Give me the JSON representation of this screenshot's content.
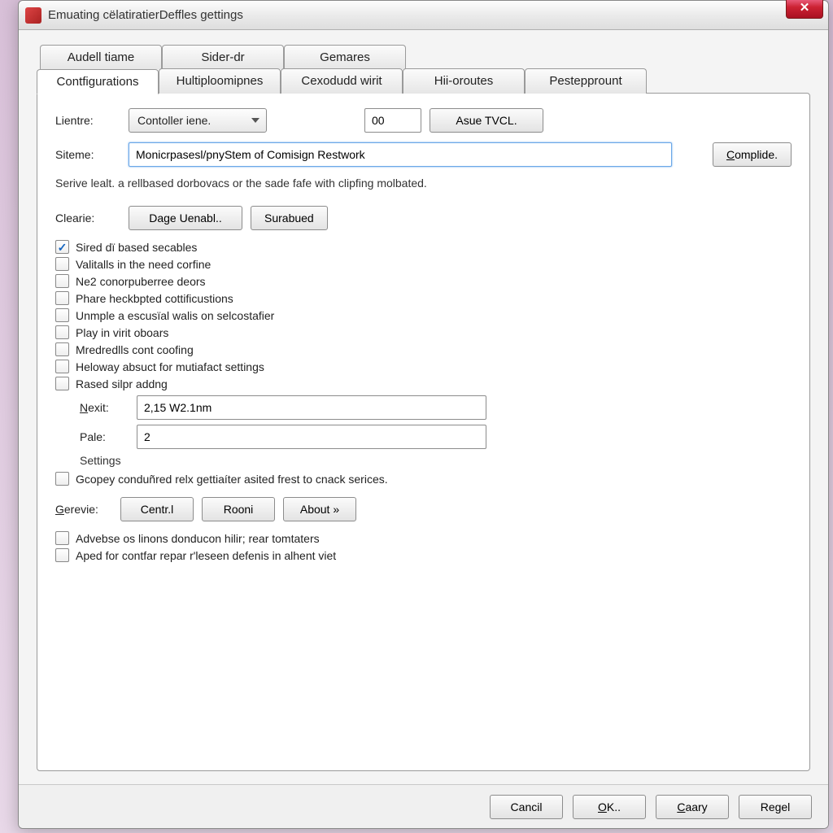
{
  "window": {
    "title": "Emuating cëlatiratierDeffles gettings"
  },
  "tabs_upper": [
    {
      "label": "Audell tiame"
    },
    {
      "label": "Sider-dr"
    },
    {
      "label": "Gemares"
    }
  ],
  "tabs_lower": [
    {
      "label": "Contfigurations"
    },
    {
      "label": "Hultiploomipnes"
    },
    {
      "label": "Cexodudd wirit"
    },
    {
      "label": "Hii-oroutes"
    },
    {
      "label": "Pestepprount"
    }
  ],
  "lientre": {
    "label": "Lientre:",
    "value": "Contoller iene."
  },
  "num_input": {
    "value": "00"
  },
  "asue_btn": "Asue TVCL.",
  "siteme": {
    "label": "Siteme:",
    "value": "Monicrpasesl/pnyStem of Comisign Restwork"
  },
  "complide_btn": "Complide.",
  "help": "Serive lealt. a rellbased dorbovacs or the sade fafe with clipfing molbated.",
  "clearie": {
    "label": "Clearie:",
    "btn1": "Dage Uenabl..",
    "btn2": "Surabued"
  },
  "checks": [
    {
      "label": "Sired dï based secables",
      "checked": true
    },
    {
      "label": "Valitalls in the need corfine",
      "checked": false
    },
    {
      "label": "Ne2 conorpuberree deors",
      "checked": false
    },
    {
      "label": "Phare heckbpted cottificustions",
      "checked": false
    },
    {
      "label": "Unmple a escusïal walis on selcostafier",
      "checked": false
    },
    {
      "label": "Play in virit oboars",
      "checked": false
    },
    {
      "label": "Mredredlls cont coofing",
      "checked": false
    },
    {
      "label": "Heloway absuct for mutiafact settings",
      "checked": false
    },
    {
      "label": "Rased silpr addng",
      "checked": false
    }
  ],
  "nexit": {
    "label": "Nexit:",
    "value": "2,15 W2.1nm"
  },
  "pale": {
    "label": "Pale:",
    "value": "2"
  },
  "settings_label": "Settings",
  "gcopey": {
    "label": "Gcopey conduñred relx gettiaíter asited frest to cnack serices.",
    "checked": false
  },
  "gerevie": {
    "label": "Gerevie:",
    "btn1": "Centr.l",
    "btn2": "Rooni",
    "btn3": "About »"
  },
  "bottom_checks": [
    {
      "label": "Advebse os linons donducon hilir; rear tomtaters",
      "checked": false
    },
    {
      "label": "Aped for contfar repar r'leseen defenis in alhent viet",
      "checked": false
    }
  ],
  "footer": {
    "cancel": "Cancil",
    "ok": "OK..",
    "carry": "Caary",
    "regel": "Regel"
  }
}
